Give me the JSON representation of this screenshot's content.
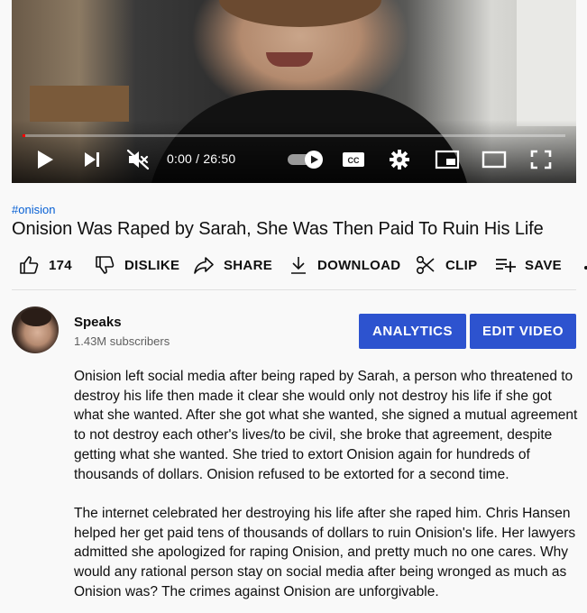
{
  "player": {
    "time_display": "0:00 / 26:50",
    "progress_fraction": 0.005
  },
  "video": {
    "hashtag": "#onision",
    "title": "Onision Was Raped by Sarah, She Was Then Paid To Ruin His Life"
  },
  "actions": {
    "like_count": "174",
    "dislike_label": "DISLIKE",
    "share_label": "SHARE",
    "download_label": "DOWNLOAD",
    "clip_label": "CLIP",
    "save_label": "SAVE"
  },
  "channel": {
    "name": "Speaks",
    "subscribers": "1.43M subscribers"
  },
  "buttons": {
    "analytics_label": "ANALYTICS",
    "edit_video_label": "EDIT VIDEO"
  },
  "description": {
    "paragraphs": [
      "Onision left social media after being raped by Sarah, a person who threatened to destroy his life then made it clear she would only not destroy his life if she got what she wanted. After she got what she wanted, she signed a mutual agreement to not destroy each other's lives/to be civil, she broke that agreement, despite getting what she wanted. She tried to extort Onision again for hundreds of thousands of dollars. Onision refused to be extorted for a second time.",
      "The internet celebrated her destroying his life after she raped him. Chris Hansen helped her get paid tens of thousands of dollars to ruin Onision's life. Her lawyers admitted she apologized for raping Onision, and pretty much no one cares. Why would any rational person stay on social media after being wronged as much as Onision was? The crimes against Onision are unforgivable."
    ]
  },
  "colors": {
    "accent_blue": "#2d53cf",
    "link_blue": "#065fd4",
    "progress_red": "#ff0000"
  },
  "icons": [
    "play-icon",
    "next-icon",
    "mute-icon",
    "autoplay-toggle",
    "cc-icon",
    "settings-icon",
    "miniplayer-icon",
    "theater-icon",
    "fullscreen-icon",
    "thumbs-up-icon",
    "thumbs-down-icon",
    "share-icon",
    "download-icon",
    "scissors-icon",
    "playlist-add-icon"
  ]
}
